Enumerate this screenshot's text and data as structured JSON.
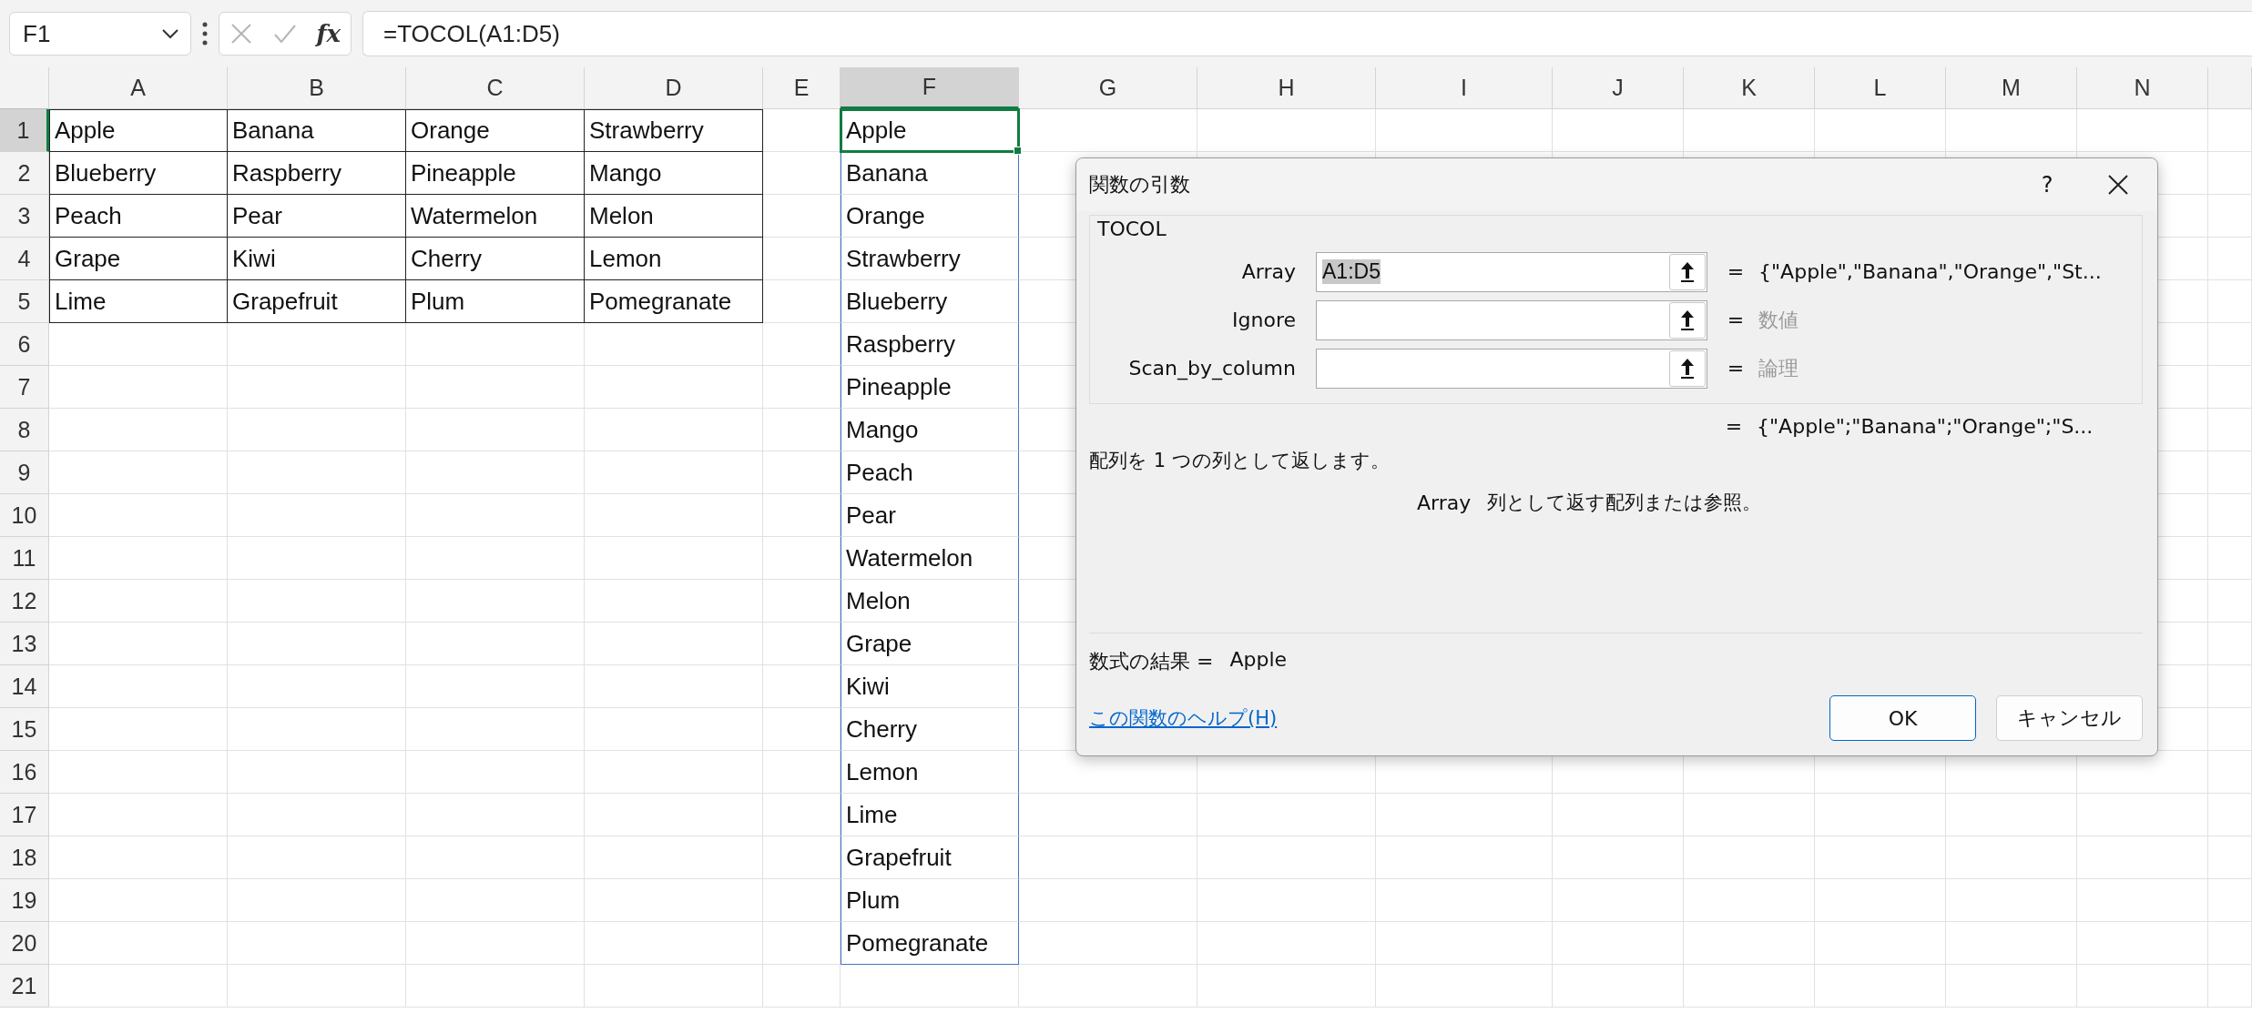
{
  "name_box": {
    "value": "F1"
  },
  "formula_bar": {
    "function_glyph": "fx",
    "value": "=TOCOL(A1:D5)"
  },
  "columns": [
    {
      "label": "A",
      "selected": false
    },
    {
      "label": "B",
      "selected": false
    },
    {
      "label": "C",
      "selected": false
    },
    {
      "label": "D",
      "selected": false
    },
    {
      "label": "E",
      "selected": false
    },
    {
      "label": "F",
      "selected": true
    },
    {
      "label": "G",
      "selected": false
    },
    {
      "label": "H",
      "selected": false
    },
    {
      "label": "I",
      "selected": false
    },
    {
      "label": "J",
      "selected": false
    },
    {
      "label": "K",
      "selected": false
    },
    {
      "label": "L",
      "selected": false
    },
    {
      "label": "M",
      "selected": false
    },
    {
      "label": "N",
      "selected": false
    }
  ],
  "rows": [
    {
      "label": "1",
      "selected": true
    },
    {
      "label": "2",
      "selected": false
    },
    {
      "label": "3",
      "selected": false
    },
    {
      "label": "4",
      "selected": false
    },
    {
      "label": "5",
      "selected": false
    },
    {
      "label": "6",
      "selected": false
    },
    {
      "label": "7",
      "selected": false
    },
    {
      "label": "8",
      "selected": false
    },
    {
      "label": "9",
      "selected": false
    },
    {
      "label": "10",
      "selected": false
    },
    {
      "label": "11",
      "selected": false
    },
    {
      "label": "12",
      "selected": false
    },
    {
      "label": "13",
      "selected": false
    },
    {
      "label": "14",
      "selected": false
    },
    {
      "label": "15",
      "selected": false
    },
    {
      "label": "16",
      "selected": false
    },
    {
      "label": "17",
      "selected": false
    },
    {
      "label": "18",
      "selected": false
    },
    {
      "label": "19",
      "selected": false
    },
    {
      "label": "20",
      "selected": false
    },
    {
      "label": "21",
      "selected": false
    }
  ],
  "source_table": {
    "rows": [
      [
        "Apple",
        "Banana",
        "Orange",
        "Strawberry"
      ],
      [
        "Blueberry",
        "Raspberry",
        "Pineapple",
        "Mango"
      ],
      [
        "Peach",
        "Pear",
        "Watermelon",
        "Melon"
      ],
      [
        "Grape",
        "Kiwi",
        "Cherry",
        "Lemon"
      ],
      [
        "Lime",
        "Grapefruit",
        "Plum",
        "Pomegranate"
      ]
    ]
  },
  "spill_column": {
    "values": [
      "Apple",
      "Banana",
      "Orange",
      "Strawberry",
      "Blueberry",
      "Raspberry",
      "Pineapple",
      "Mango",
      "Peach",
      "Pear",
      "Watermelon",
      "Melon",
      "Grape",
      "Kiwi",
      "Cherry",
      "Lemon",
      "Lime",
      "Grapefruit",
      "Plum",
      "Pomegranate"
    ]
  },
  "dialog": {
    "title": "関数の引数",
    "help_glyph": "?",
    "function_name": "TOCOL",
    "arguments": [
      {
        "label": "Array",
        "value": "A1:D5",
        "text_selected": true,
        "sign": "=",
        "result": "{\"Apple\",\"Banana\",\"Orange\",\"St...",
        "result_muted": false
      },
      {
        "label": "Ignore",
        "text_selected": false,
        "sign": "=",
        "result": "数値",
        "result_muted": true
      },
      {
        "label": "Scan_by_column",
        "text_selected": false,
        "sign": "=",
        "result": "論理",
        "result_muted": true
      }
    ],
    "overall_result": {
      "sign": "=",
      "value": "{\"Apple\";\"Banana\";\"Orange\";\"S..."
    },
    "description": "配列を 1 つの列として返します。",
    "argument_help": {
      "name": "Array",
      "text": "列として返す配列または参照。"
    },
    "formula_result": {
      "label": "数式の結果 =",
      "value": "Apple"
    },
    "help_link": "この関数のヘルプ(H)",
    "buttons": [
      {
        "label": "OK",
        "default": true
      },
      {
        "label": "キャンセル",
        "default": false
      }
    ]
  }
}
